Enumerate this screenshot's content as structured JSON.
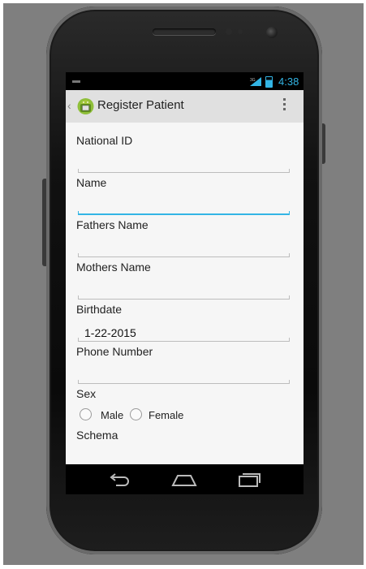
{
  "status_bar": {
    "time": "4:38",
    "network": "3G"
  },
  "action_bar": {
    "title": "Register Patient"
  },
  "form": {
    "national_id": {
      "label": "National ID",
      "value": ""
    },
    "name": {
      "label": "Name",
      "value": ""
    },
    "fathers_name": {
      "label": "Fathers Name",
      "value": ""
    },
    "mothers_name": {
      "label": "Mothers Name",
      "value": ""
    },
    "birthdate": {
      "label": "Birthdate",
      "value": "1-22-2015"
    },
    "phone_number": {
      "label": "Phone Number",
      "value": ""
    },
    "sex": {
      "label": "Sex",
      "options": [
        "Male",
        "Female"
      ]
    },
    "schema": {
      "label": "Schema"
    }
  },
  "colors": {
    "accent": "#33b5e5",
    "action_bar": "#e0e0e0",
    "content_bg": "#f6f6f6"
  }
}
